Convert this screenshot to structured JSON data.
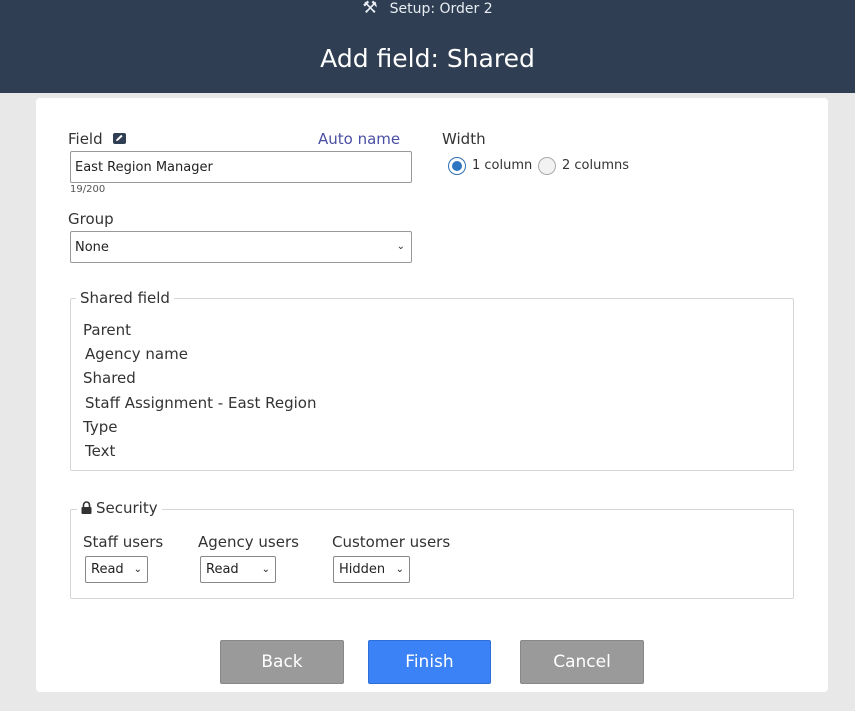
{
  "header": {
    "crumb": "Setup: Order 2",
    "title": "Add field: Shared",
    "tools_icon": "tools-icon"
  },
  "form": {
    "field_label": "Field",
    "auto_name": "Auto name",
    "field_value": "East Region Manager",
    "field_counter": "19/200",
    "width_label": "Width",
    "width_options": [
      "1 column",
      "2 columns"
    ],
    "width_selected": "1 column",
    "group_label": "Group",
    "group_value": "None"
  },
  "shared_field": {
    "legend": "Shared field",
    "parent_label": "Parent",
    "parent_value": "Agency name",
    "shared_label": "Shared",
    "shared_value": "Staff Assignment - East Region",
    "type_label": "Type",
    "type_value": "Text"
  },
  "security": {
    "legend": "Security",
    "staff_label": "Staff users",
    "staff_value": "Read",
    "agency_label": "Agency users",
    "agency_value": "Read",
    "customer_label": "Customer users",
    "customer_value": "Hidden"
  },
  "buttons": {
    "back": "Back",
    "finish": "Finish",
    "cancel": "Cancel"
  },
  "colors": {
    "header_bg": "#2f3e52",
    "primary": "#3b82f6",
    "secondary": "#9a9a9a",
    "link": "#4a4fa3"
  }
}
